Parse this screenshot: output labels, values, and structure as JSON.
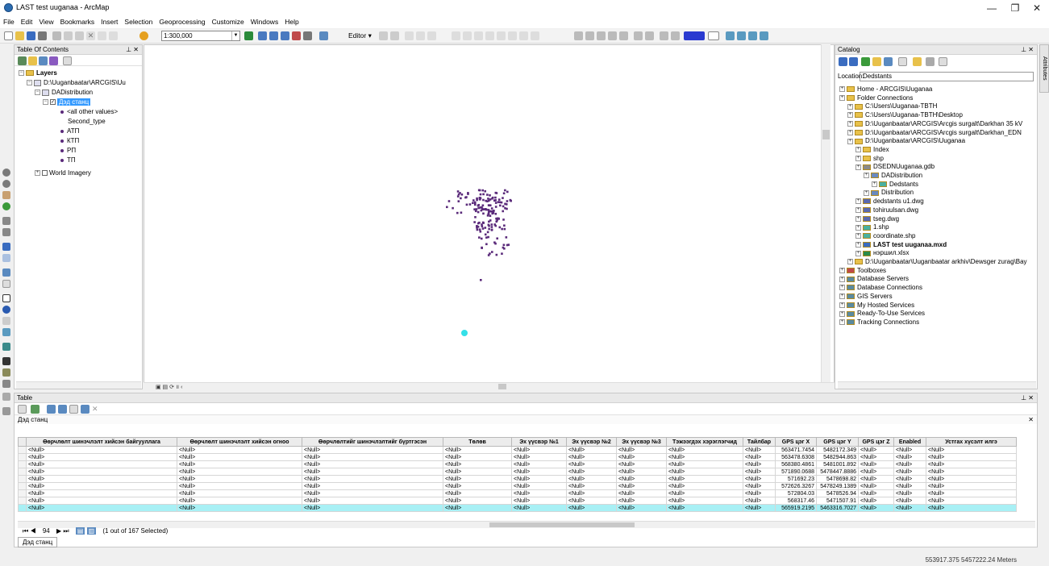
{
  "window": {
    "title": "LAST test uuganaa - ArcMap",
    "minimize": "—",
    "maximize": "❐",
    "close": "✕"
  },
  "menu": [
    "File",
    "Edit",
    "View",
    "Bookmarks",
    "Insert",
    "Selection",
    "Geoprocessing",
    "Customize",
    "Windows",
    "Help"
  ],
  "toolbar": {
    "scale": "1:300,000",
    "editor": "Editor ▾"
  },
  "toc": {
    "title": "Table Of Contents",
    "layers_root": "Layers",
    "path": "D:\\Uuganbaatar\\ARCGIS\\Uu",
    "dataset": "DADistribution",
    "layer": "Дэд станц",
    "legend_header_1": "<all other values>",
    "legend_header_2": "Second_type",
    "classes": [
      "АТП",
      "КТП",
      "РП",
      "ТП"
    ],
    "basemap": "World Imagery"
  },
  "catalog": {
    "title": "Catalog",
    "location_label": "Location:",
    "location_value": "Dedstants",
    "items": [
      {
        "text": "Home - ARCGIS\\Uuganaa",
        "indent": 0,
        "icon": "folder"
      },
      {
        "text": "Folder Connections",
        "indent": 0,
        "icon": "folder"
      },
      {
        "text": "C:\\Users\\Uuganaa-TBTH",
        "indent": 1,
        "icon": "folder"
      },
      {
        "text": "C:\\Users\\Uuganaa-TBTH\\Desktop",
        "indent": 1,
        "icon": "folder"
      },
      {
        "text": "D:\\Uuganbaatar\\ARCGIS\\Arcgis surgalt\\Darkhan 35 kV",
        "indent": 1,
        "icon": "folder"
      },
      {
        "text": "D:\\Uuganbaatar\\ARCGIS\\Arcgis surgalt\\Darkhan_EDN",
        "indent": 1,
        "icon": "folder"
      },
      {
        "text": "D:\\Uuganbaatar\\ARCGIS\\Uuganaa",
        "indent": 1,
        "icon": "folder"
      },
      {
        "text": "Index",
        "indent": 2,
        "icon": "folder"
      },
      {
        "text": "shp",
        "indent": 2,
        "icon": "folder"
      },
      {
        "text": "DSEDNUuganaa.gdb",
        "indent": 2,
        "icon": "gdb"
      },
      {
        "text": "DADistribution",
        "indent": 3,
        "icon": "dataset"
      },
      {
        "text": "Dedstants",
        "indent": 4,
        "icon": "fc"
      },
      {
        "text": "Distribution",
        "indent": 3,
        "icon": "dataset"
      },
      {
        "text": "dedstants u1.dwg",
        "indent": 2,
        "icon": "dwg"
      },
      {
        "text": "tohiruulsan.dwg",
        "indent": 2,
        "icon": "dwg"
      },
      {
        "text": "tseg.dwg",
        "indent": 2,
        "icon": "dwg"
      },
      {
        "text": "1.shp",
        "indent": 2,
        "icon": "fc"
      },
      {
        "text": "coordinate.shp",
        "indent": 2,
        "icon": "fc"
      },
      {
        "text": "LAST test uuganaa.mxd",
        "indent": 2,
        "icon": "mxd"
      },
      {
        "text": "нэршил.xlsx",
        "indent": 2,
        "icon": "xls"
      },
      {
        "text": "D:\\Uuganbaatar\\Uuganbaatar arkhiv\\Dewsger zurag\\Bay",
        "indent": 1,
        "icon": "folder"
      },
      {
        "text": "Toolboxes",
        "indent": 0,
        "icon": "tool"
      },
      {
        "text": "Database Servers",
        "indent": 0,
        "icon": "db"
      },
      {
        "text": "Database Connections",
        "indent": 0,
        "icon": "db"
      },
      {
        "text": "GIS Servers",
        "indent": 0,
        "icon": "db"
      },
      {
        "text": "My Hosted Services",
        "indent": 0,
        "icon": "db"
      },
      {
        "text": "Ready-To-Use Services",
        "indent": 0,
        "icon": "db"
      },
      {
        "text": "Tracking Connections",
        "indent": 0,
        "icon": "db"
      }
    ]
  },
  "attributes_tab": "Attributes",
  "table": {
    "title": "Table",
    "layer_name": "Дэд станц",
    "columns": [
      "Өөрчлөлт шинэчлэлт хийсэн байгууллага",
      "Өөрчлөлт шинэчлэлт хийсэн огноо",
      "Өөрчлөлтийг шинэчлэлтийг бүртгэсэн",
      "Төлөв",
      "Эх үүсвэр №1",
      "Эх үүсвэр №2",
      "Эх үүсвэр №3",
      "Тэжээгдэх хэрэглэгчид",
      "Тайлбар",
      "GPS цэг X",
      "GPS цэг Y",
      "GPS цэг Z",
      "Enabled",
      "Устгах хүсэлт илгэ"
    ],
    "rows": [
      [
        "<Null>",
        "<Null>",
        "<Null>",
        "<Null>",
        "<Null>",
        "<Null>",
        "<Null>",
        "<Null>",
        "<Null>",
        "563471.7454",
        "5482172.349",
        "<Null>",
        "<Null>",
        "<Null>"
      ],
      [
        "<Null>",
        "<Null>",
        "<Null>",
        "<Null>",
        "<Null>",
        "<Null>",
        "<Null>",
        "<Null>",
        "<Null>",
        "563478.6308",
        "5482944.863",
        "<Null>",
        "<Null>",
        "<Null>"
      ],
      [
        "<Null>",
        "<Null>",
        "<Null>",
        "<Null>",
        "<Null>",
        "<Null>",
        "<Null>",
        "<Null>",
        "<Null>",
        "568380.4861",
        "5481001.892",
        "<Null>",
        "<Null>",
        "<Null>"
      ],
      [
        "<Null>",
        "<Null>",
        "<Null>",
        "<Null>",
        "<Null>",
        "<Null>",
        "<Null>",
        "<Null>",
        "<Null>",
        "571890.0688",
        "5478447.8886",
        "<Null>",
        "<Null>",
        "<Null>"
      ],
      [
        "<Null>",
        "<Null>",
        "<Null>",
        "<Null>",
        "<Null>",
        "<Null>",
        "<Null>",
        "<Null>",
        "<Null>",
        "571692.23",
        "5478698.82",
        "<Null>",
        "<Null>",
        "<Null>"
      ],
      [
        "<Null>",
        "<Null>",
        "<Null>",
        "<Null>",
        "<Null>",
        "<Null>",
        "<Null>",
        "<Null>",
        "<Null>",
        "572626.3267",
        "5478249.1389",
        "<Null>",
        "<Null>",
        "<Null>"
      ],
      [
        "<Null>",
        "<Null>",
        "<Null>",
        "<Null>",
        "<Null>",
        "<Null>",
        "<Null>",
        "<Null>",
        "<Null>",
        "572804.03",
        "5478526.94",
        "<Null>",
        "<Null>",
        "<Null>"
      ],
      [
        "<Null>",
        "<Null>",
        "<Null>",
        "<Null>",
        "<Null>",
        "<Null>",
        "<Null>",
        "<Null>",
        "<Null>",
        "568317.46",
        "5471507.91",
        "<Null>",
        "<Null>",
        "<Null>"
      ],
      [
        "<Null>",
        "<Null>",
        "<Null>",
        "<Null>",
        "<Null>",
        "<Null>",
        "<Null>",
        "<Null>",
        "<Null>",
        "565919.2195",
        "5463316.7027",
        "<Null>",
        "<Null>",
        "<Null>"
      ]
    ],
    "highlighted_row": 8,
    "current_record": "94",
    "selection_text": "(1 out of 167 Selected)",
    "bottom_tab": "Дэд станц"
  },
  "status": {
    "coordinates": "553917.375  5457222.24 Meters"
  },
  "colors": {
    "point": "#5a2a7a",
    "selected": "#34e0e8",
    "highlight_row": "#a8f0f5",
    "selection_blue": "#3399ff"
  }
}
